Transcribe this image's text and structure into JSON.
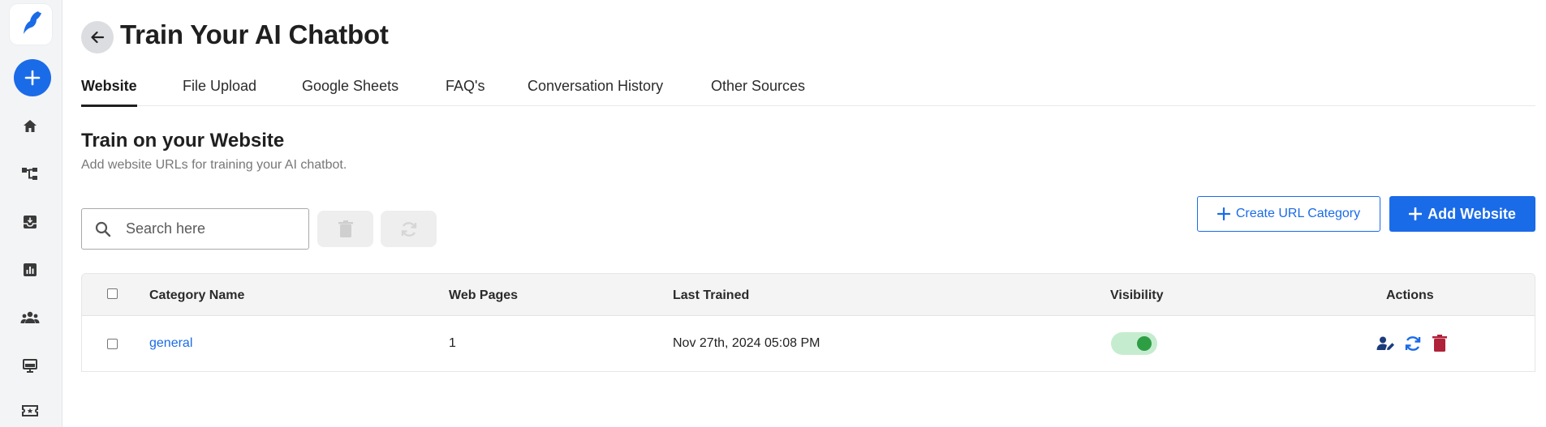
{
  "page": {
    "title": "Train Your AI Chatbot"
  },
  "sidebar": {
    "items": [
      {
        "icon": "home-icon"
      },
      {
        "icon": "flow-icon"
      },
      {
        "icon": "inbox-icon"
      },
      {
        "icon": "analytics-icon"
      },
      {
        "icon": "team-icon"
      },
      {
        "icon": "monitor-icon"
      },
      {
        "icon": "ticket-icon"
      }
    ]
  },
  "tabs": [
    {
      "label": "Website",
      "active": true
    },
    {
      "label": "File Upload",
      "active": false
    },
    {
      "label": "Google Sheets",
      "active": false
    },
    {
      "label": "FAQ's",
      "active": false
    },
    {
      "label": "Conversation History",
      "active": false
    },
    {
      "label": "Other Sources",
      "active": false
    }
  ],
  "section": {
    "title": "Train on your Website",
    "subtitle": "Add website URLs for training your AI chatbot."
  },
  "toolbar": {
    "search_placeholder": "Search here",
    "create_category_label": "Create URL Category",
    "add_website_label": "Add Website"
  },
  "table": {
    "headers": {
      "category": "Category Name",
      "pages": "Web Pages",
      "trained": "Last Trained",
      "visibility": "Visibility",
      "actions": "Actions"
    },
    "rows": [
      {
        "category": "general",
        "pages": "1",
        "trained": "Nov 27th, 2024 05:08 PM",
        "visible": true
      }
    ]
  },
  "colors": {
    "accent": "#1a6be8",
    "toggle_on": "#2e9e44",
    "delete": "#b0213a",
    "edit": "#1b3b7a"
  }
}
